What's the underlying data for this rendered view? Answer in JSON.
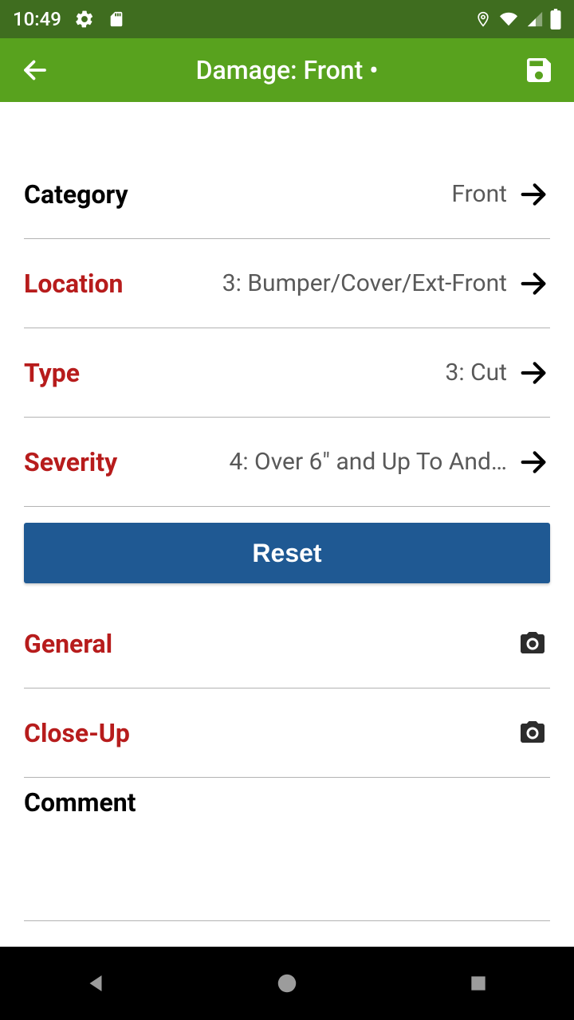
{
  "status": {
    "time": "10:49"
  },
  "header": {
    "title": "Damage: Front •"
  },
  "rows": {
    "category": {
      "label": "Category",
      "value": "Front"
    },
    "location": {
      "label": "Location",
      "value": "3: Bumper/Cover/Ext-Front"
    },
    "type": {
      "label": "Type",
      "value": "3: Cut"
    },
    "severity": {
      "label": "Severity",
      "value": "4: Over 6\" and Up To And…"
    },
    "general": {
      "label": "General"
    },
    "closeup": {
      "label": "Close-Up"
    }
  },
  "buttons": {
    "reset": "Reset"
  },
  "comment": {
    "label": "Comment"
  }
}
